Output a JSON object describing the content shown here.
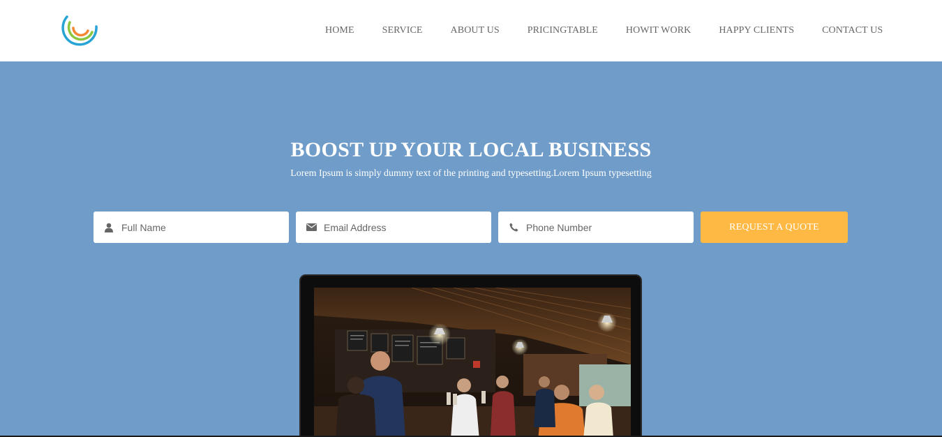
{
  "header": {
    "logo_icon": "concentric-arcs-logo",
    "nav": [
      {
        "label": "HOME"
      },
      {
        "label": "SERVICE"
      },
      {
        "label": "ABOUT US"
      },
      {
        "label": "PRICINGTABLE"
      },
      {
        "label": "HOWIT WORK"
      },
      {
        "label": "HAPPY CLIENTS"
      },
      {
        "label": "CONTACT US"
      }
    ]
  },
  "hero": {
    "title": "BOOST UP YOUR LOCAL BUSINESS",
    "subtitle": "Lorem Ipsum is simply dummy text of the printing and typesetting.Lorem Ipsum typesetting"
  },
  "form": {
    "name": {
      "placeholder": "Full Name",
      "value": "",
      "icon": "user-icon"
    },
    "email": {
      "placeholder": "Email Address",
      "value": "",
      "icon": "envelope-icon"
    },
    "phone": {
      "placeholder": "Phone Number",
      "value": "",
      "icon": "phone-icon"
    },
    "submit_label": "REQUEST A QUOTE"
  },
  "colors": {
    "hero_bg": "#6f9cc9",
    "accent": "#fdb943",
    "header_bg": "#ffffff",
    "nav_text": "#666666"
  }
}
